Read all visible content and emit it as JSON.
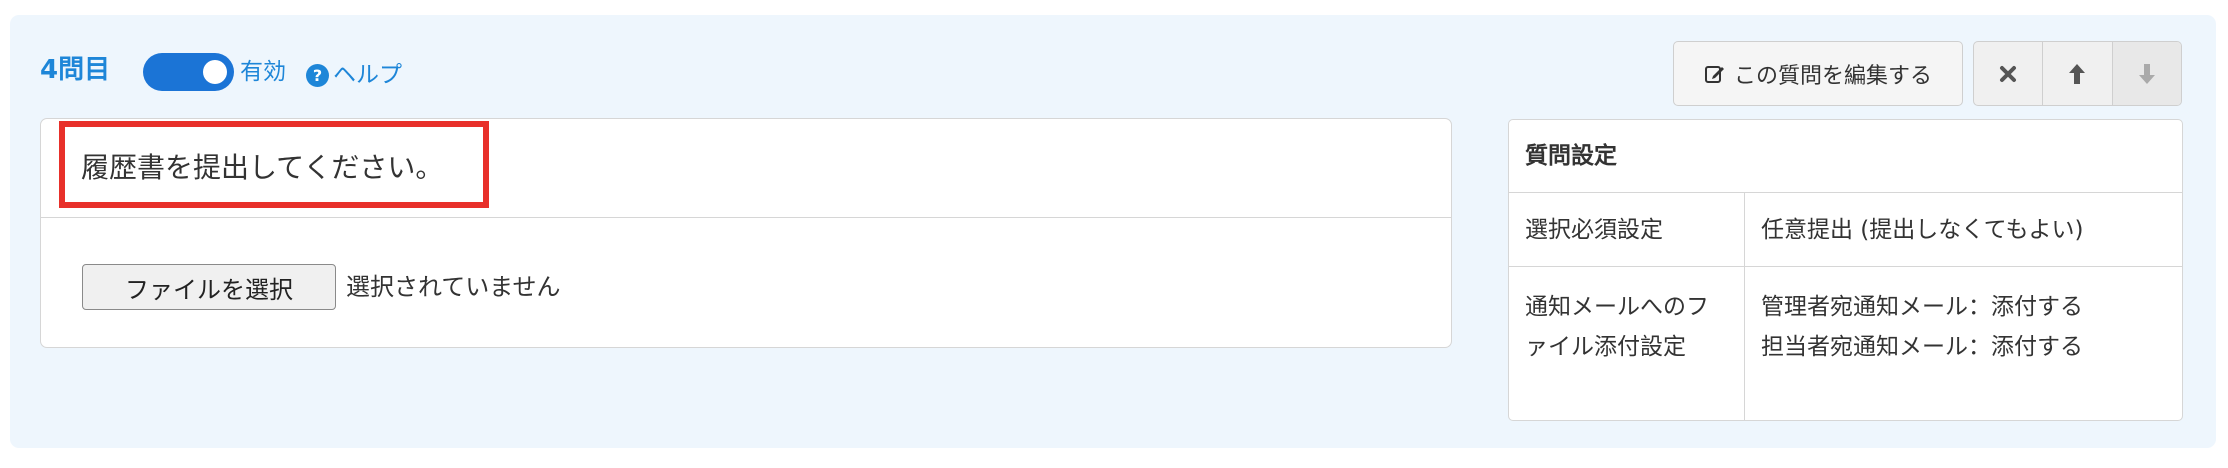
{
  "header": {
    "question_number": "4問目",
    "toggle_label": "有効",
    "toggle_on": true,
    "help_label": "ヘルプ",
    "help_icon_glyph": "?"
  },
  "toolbar": {
    "edit_label": "この質問を編集する",
    "delete_icon": "close-icon",
    "up_icon": "arrow-up-icon",
    "down_icon": "arrow-down-icon"
  },
  "question": {
    "title": "履歴書を提出してください。",
    "file_button_label": "ファイルを選択",
    "file_status": "選択されていません"
  },
  "settings": {
    "title": "質問設定",
    "rows": [
      {
        "label": "選択必須設定",
        "values": [
          "任意提出 (提出しなくてもよい)"
        ]
      },
      {
        "label": "通知メールへのファイル添付設定",
        "values": [
          "管理者宛通知メール：添付する",
          "担当者宛通知メール：添付する"
        ]
      }
    ]
  },
  "colors": {
    "accent": "#1e86d8",
    "toggle": "#1b74d6",
    "highlight": "#e8302a",
    "panel_bg": "#eef6fd"
  }
}
